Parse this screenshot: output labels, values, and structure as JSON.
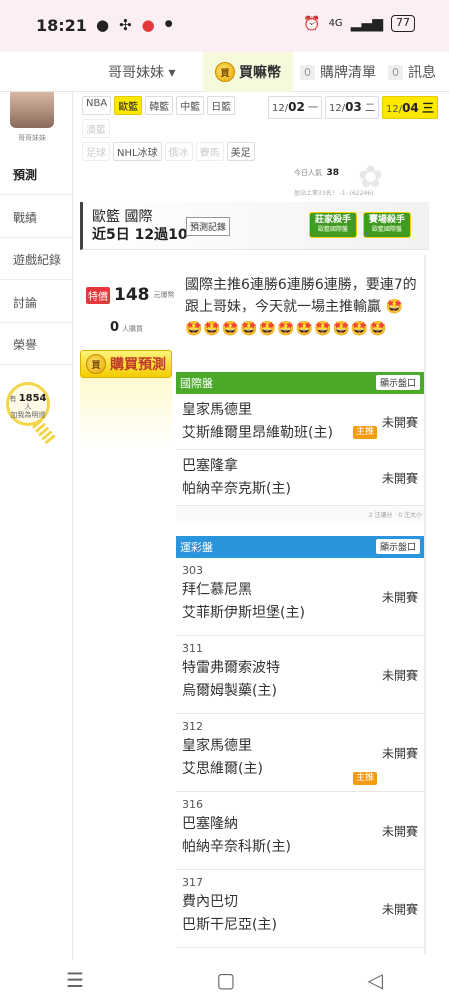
{
  "status_bar": {
    "time": "18:21",
    "left_icons": [
      "chat-icon",
      "pinwheel-icon",
      "app-icon",
      "dot-icon"
    ],
    "battery": "77",
    "network": "4G"
  },
  "header": {
    "user_menu": "哥哥妹妹 ▾",
    "buy_coin": "買嘛幣",
    "list_count": "0",
    "list_label": "購牌清單",
    "msg_count": "0",
    "msg_label": "訊息"
  },
  "sidebar": {
    "avatar_name": "哥哥妹妹",
    "items": [
      {
        "label": "預測",
        "active": true
      },
      {
        "label": "戰績"
      },
      {
        "label": "遊戲紀錄"
      },
      {
        "label": "討論"
      },
      {
        "label": "榮譽"
      }
    ],
    "bulb_prefix": "有",
    "bulb_count": "1854",
    "bulb_unit": "人",
    "bulb_text": "加我為明燈"
  },
  "leagues": {
    "row1": [
      {
        "label": "NBA"
      },
      {
        "label": "歐籃",
        "selected": true
      },
      {
        "label": "韓籃"
      },
      {
        "label": "中籃"
      },
      {
        "label": "日籃"
      }
    ],
    "row2": [
      {
        "label": "澳籃",
        "dim": true
      }
    ],
    "row3": [
      {
        "label": "足球",
        "dim": true
      },
      {
        "label": "NHL冰球"
      },
      {
        "label": "俄冰",
        "dim": true
      },
      {
        "label": "賽馬",
        "dim": true
      },
      {
        "label": "美足"
      }
    ]
  },
  "dates": [
    {
      "md": "12/",
      "day": "02",
      "wd": "一"
    },
    {
      "md": "12/",
      "day": "03",
      "wd": "二"
    },
    {
      "md": "12/",
      "day": "04",
      "wd": "三",
      "selected": true
    }
  ],
  "today": {
    "label": "今日人氣",
    "value": "38",
    "rank": "盈站上第33名！ -1- (62246)"
  },
  "forecast": {
    "title_line1": "歐籃 國際",
    "title_line2": "近5日 12過10",
    "record_button": "預測記錄",
    "badge1_title": "莊家殺手",
    "badge1_sub": "歐籃國際盤",
    "badge2_title": "賽場殺手",
    "badge2_sub": "歐籃國際盤"
  },
  "price": {
    "tag": "特價",
    "value": "148",
    "unit": "元爆幣",
    "buyers_count": "0",
    "buyers_unit": "人購買"
  },
  "buy_button": "購買預測",
  "description": "國際主推6連勝6連勝6連勝，要連7的跟上哥妹，今天就一場主推輸贏",
  "emojis": "🤩🤩🤩🤩🤩🤩🤩🤩🤩🤩🤩🤩",
  "board_intl": {
    "title": "國際盤",
    "toggle": "顯示盤口",
    "matches": [
      {
        "team1": "皇家馬德里",
        "team2": "艾斯維爾里昂維勒班(主)",
        "status": "未開賽",
        "main_tag": "主推"
      },
      {
        "team1": "巴塞隆拿",
        "team2": "帕納辛奈克斯(主)",
        "status": "未開賽"
      }
    ],
    "note": "2 注讓分 · 0 注大小"
  },
  "board_lottery": {
    "title": "運彩盤",
    "toggle": "顯示盤口",
    "matches": [
      {
        "num": "303",
        "team1": "拜仁慕尼黑",
        "team2": "艾菲斯伊斯坦堡(主)",
        "status": "未開賽"
      },
      {
        "num": "311",
        "team1": "特雷弗爾索波特",
        "team2": "烏爾姆製藥(主)",
        "status": "未開賽"
      },
      {
        "num": "312",
        "team1": "皇家馬德里",
        "team2": "艾思維爾(主)",
        "status": "未開賽",
        "main_tag": "主推"
      },
      {
        "num": "316",
        "team1": "巴塞隆納",
        "team2": "帕納辛奈科斯(主)",
        "status": "未開賽"
      },
      {
        "num": "317",
        "team1": "費內巴切",
        "team2": "巴斯干尼亞(主)",
        "status": "未開賽"
      }
    ]
  },
  "navbar": {
    "menu": "☰",
    "home": "▢",
    "back": "◁"
  }
}
